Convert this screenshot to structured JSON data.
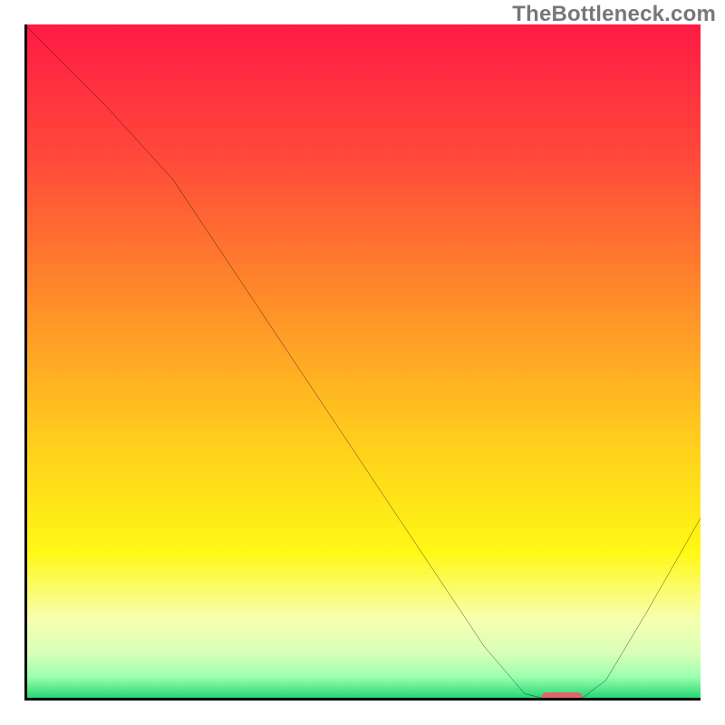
{
  "watermark": "TheBottleneck.com",
  "chart_data": {
    "type": "line",
    "title": "",
    "xlabel": "",
    "ylabel": "",
    "xlim": [
      0,
      100
    ],
    "ylim": [
      0,
      100
    ],
    "x": [
      0,
      12,
      22,
      34,
      46,
      58,
      68,
      74,
      78,
      82,
      86,
      92,
      100
    ],
    "values": [
      100,
      88,
      77,
      59,
      41,
      23,
      8,
      1,
      0,
      0,
      3,
      13,
      27
    ],
    "marker": {
      "x_start": 76.5,
      "x_end": 82.5,
      "y": 0.6,
      "color": "#e06666"
    },
    "background_gradient": {
      "stops": [
        {
          "pos": 0,
          "color": "#ff1a44"
        },
        {
          "pos": 0.2,
          "color": "#ff4a3a"
        },
        {
          "pos": 0.4,
          "color": "#ff8a2a"
        },
        {
          "pos": 0.6,
          "color": "#ffc91e"
        },
        {
          "pos": 0.78,
          "color": "#fff814"
        },
        {
          "pos": 0.88,
          "color": "#f7ffb0"
        },
        {
          "pos": 0.93,
          "color": "#d8ffb8"
        },
        {
          "pos": 0.965,
          "color": "#9bffb0"
        },
        {
          "pos": 1.0,
          "color": "#18d16a"
        }
      ]
    }
  }
}
